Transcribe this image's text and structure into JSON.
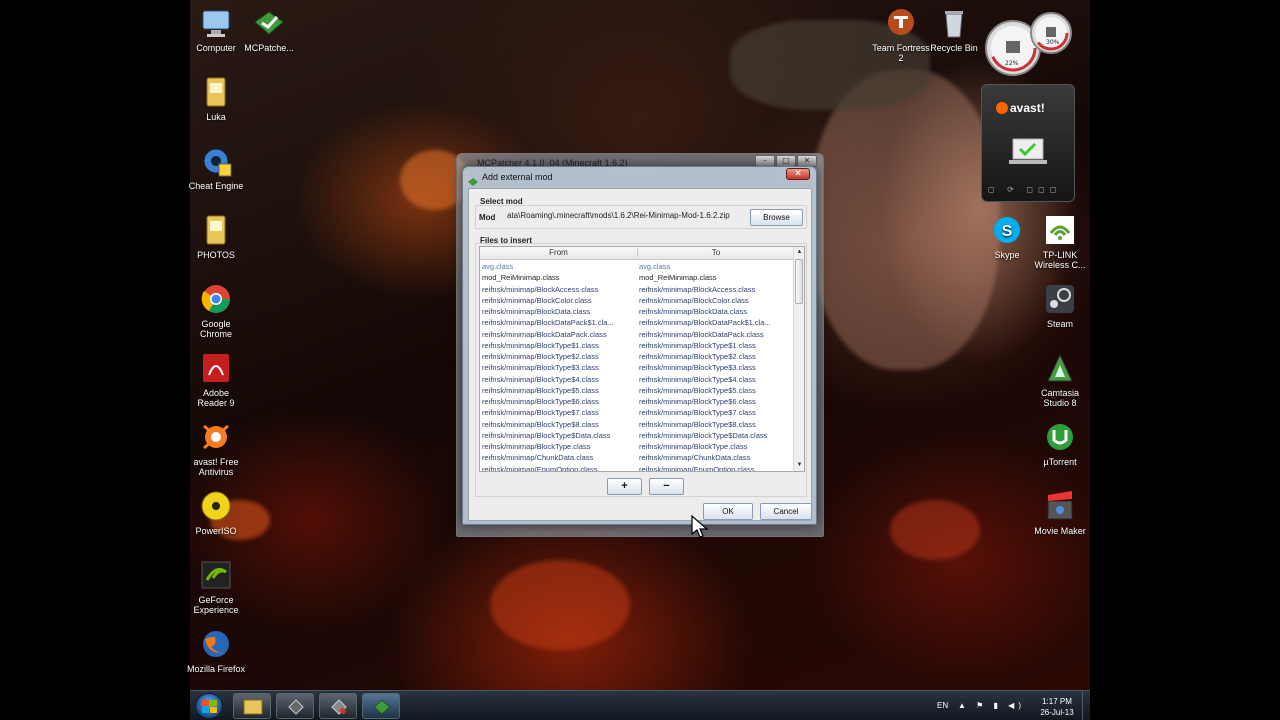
{
  "desktop_icons": {
    "computer": "Computer",
    "mcpatcher": "MCPatche...",
    "luka": "Luka",
    "cheat_engine": "Cheat Engine",
    "photos": "PHOTOS",
    "google_chrome": "Google Chrome",
    "adobe_reader": "Adobe Reader 9",
    "avast": "avast! Free Antivirus",
    "poweriso": "PowerISO",
    "geforce": "GeForce Experience",
    "firefox": "Mozilla Firefox",
    "team_fortress": "Team Fortress 2",
    "recycle_bin": "Recycle Bin",
    "skype": "Skype",
    "tplink": "TP-LINK Wireless C...",
    "steam": "Steam",
    "camtasia": "Camtasia Studio 8",
    "utorrent": "µTorrent",
    "movie_maker": "Movie Maker"
  },
  "gadgets": {
    "cpu_percent": "22%",
    "ram_percent": "30%",
    "avast_brand": "avast!"
  },
  "mcpatcher_window": {
    "title": "MCPatcher 4.1.0_04 (Minecraft 1.6.2)"
  },
  "dialog": {
    "title": "Add external mod",
    "close_glyph": "✕",
    "select_mod_label": "Select mod",
    "mod_label": "Mod",
    "mod_path": "ata\\Roaming\\.minecraft\\mods\\1.6.2\\Rei-Minimap-Mod-1.6.2.zip",
    "browse_label": "Browse",
    "files_label": "Files to insert",
    "col_from": "From",
    "col_to": "To",
    "add_label": "+",
    "remove_label": "−",
    "ok_label": "OK",
    "cancel_label": "Cancel",
    "rows": [
      [
        "avg.class",
        "avg.class"
      ],
      [
        "mod_ReiMinimap.class",
        "mod_ReiMinimap.class"
      ],
      [
        "reifnsk/minimap/BlockAccess.class",
        "reifnsk/minimap/BlockAccess.class"
      ],
      [
        "reifnsk/minimap/BlockColor.class",
        "reifnsk/minimap/BlockColor.class"
      ],
      [
        "reifnsk/minimap/BlockData.class",
        "reifnsk/minimap/BlockData.class"
      ],
      [
        "reifnsk/minimap/BlockDataPack$1.cla...",
        "reifnsk/minimap/BlockDataPack$1.cla..."
      ],
      [
        "reifnsk/minimap/BlockDataPack.class",
        "reifnsk/minimap/BlockDataPack.class"
      ],
      [
        "reifnsk/minimap/BlockType$1.class",
        "reifnsk/minimap/BlockType$1.class"
      ],
      [
        "reifnsk/minimap/BlockType$2.class",
        "reifnsk/minimap/BlockType$2.class"
      ],
      [
        "reifnsk/minimap/BlockType$3.class",
        "reifnsk/minimap/BlockType$3.class"
      ],
      [
        "reifnsk/minimap/BlockType$4.class",
        "reifnsk/minimap/BlockType$4.class"
      ],
      [
        "reifnsk/minimap/BlockType$5.class",
        "reifnsk/minimap/BlockType$5.class"
      ],
      [
        "reifnsk/minimap/BlockType$6.class",
        "reifnsk/minimap/BlockType$6.class"
      ],
      [
        "reifnsk/minimap/BlockType$7.class",
        "reifnsk/minimap/BlockType$7.class"
      ],
      [
        "reifnsk/minimap/BlockType$8.class",
        "reifnsk/minimap/BlockType$8.class"
      ],
      [
        "reifnsk/minimap/BlockType$Data.class",
        "reifnsk/minimap/BlockType$Data.class"
      ],
      [
        "reifnsk/minimap/BlockType.class",
        "reifnsk/minimap/BlockType.class"
      ],
      [
        "reifnsk/minimap/ChunkData.class",
        "reifnsk/minimap/ChunkData.class"
      ],
      [
        "reifnsk/minimap/EnumOption.class",
        "reifnsk/minimap/EnumOption.class"
      ]
    ]
  },
  "taskbar": {
    "language": "EN",
    "tray_glyphs": "▲ ⚑ ▮ ◀)",
    "time": "1:17 PM",
    "date": "26-Jul-13"
  }
}
